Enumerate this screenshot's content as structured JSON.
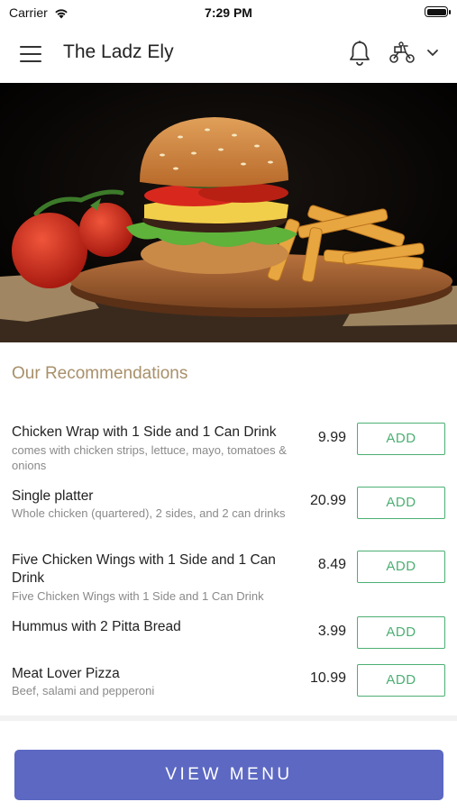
{
  "status_bar": {
    "carrier": "Carrier",
    "time": "7:29 PM"
  },
  "header": {
    "title": "The Ladz Ely"
  },
  "recommendations": {
    "title": "Our Recommendations",
    "add_label": "ADD",
    "items": [
      {
        "name": "Chicken Wrap with 1 Side and 1 Can Drink",
        "description": "comes with chicken strips, lettuce, mayo, tomatoes & onions",
        "price": "9.99"
      },
      {
        "name": "Single platter",
        "description": "Whole chicken (quartered), 2 sides, and 2 can drinks",
        "price": "20.99"
      },
      {
        "name": "Five Chicken Wings with 1 Side and 1 Can Drink",
        "description": "Five Chicken Wings with 1 Side and 1 Can Drink",
        "price": "8.49"
      },
      {
        "name": "Hummus with 2 Pitta Bread",
        "description": "",
        "price": "3.99"
      },
      {
        "name": "Meat Lover Pizza",
        "description": "Beef, salami and pepperoni",
        "price": "10.99"
      }
    ]
  },
  "footer": {
    "view_menu_label": "VIEW MENU"
  },
  "colors": {
    "accent": "#5c68c2",
    "add_green": "#4caf73",
    "section_title": "#a8906a"
  }
}
